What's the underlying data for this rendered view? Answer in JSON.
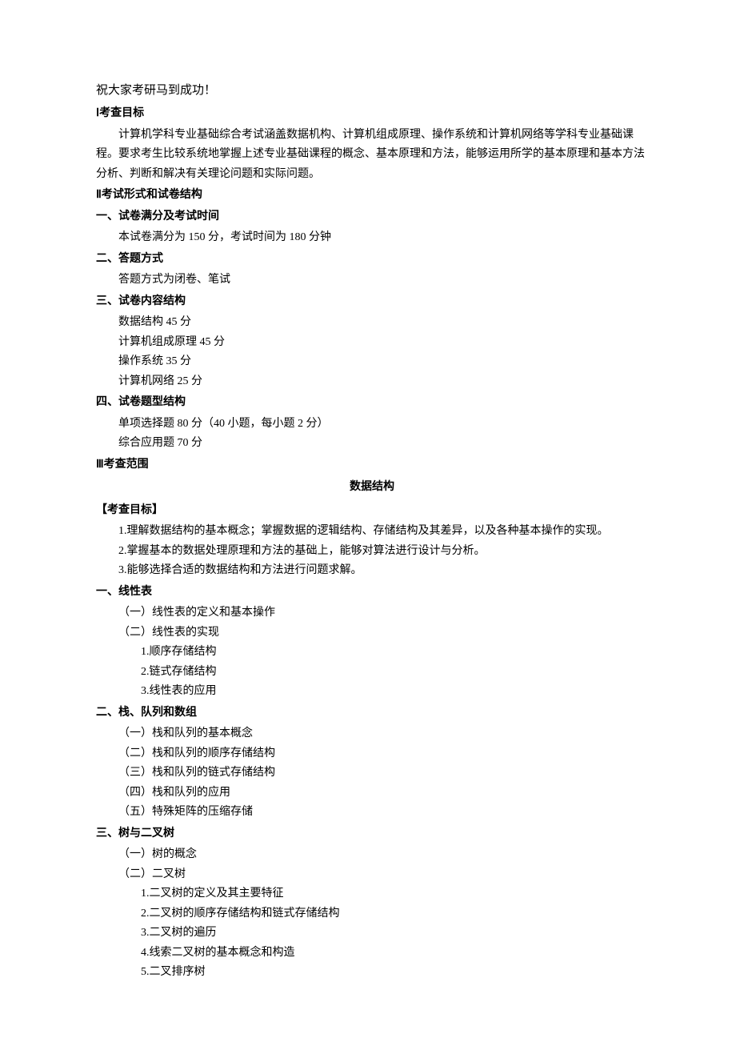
{
  "greeting": "祝大家考研马到成功！",
  "s1": {
    "title": "Ⅰ考查目标",
    "para": "计算机学科专业基础综合考试涵盖数据机构、计算机组成原理、操作系统和计算机网络等学科专业基础课程。要求考生比较系统地掌握上述专业基础课程的概念、基本原理和方法，能够运用所学的基本原理和基本方法分析、判断和解决有关理论问题和实际问题。"
  },
  "s2": {
    "title": "Ⅱ考试形式和试卷结构",
    "sub1": {
      "title": "一、试卷满分及考试时间",
      "line1": "本试卷满分为 150 分，考试时间为 180 分钟"
    },
    "sub2": {
      "title": "二、答题方式",
      "line1": "答题方式为闭卷、笔试"
    },
    "sub3": {
      "title": "三、试卷内容结构",
      "line1": "数据结构 45 分",
      "line2": "计算机组成原理 45 分",
      "line3": "操作系统 35 分",
      "line4": "计算机网络 25 分"
    },
    "sub4": {
      "title": "四、试卷题型结构",
      "line1": "单项选择题 80 分（40 小题，每小题 2 分）",
      "line2": "综合应用题 70 分"
    }
  },
  "s3": {
    "title": "Ⅲ考查范围",
    "centerTitle": "数据结构",
    "goals": {
      "title": "【考查目标】",
      "g1": "1.理解数据结构的基本概念；掌握数据的逻辑结构、存储结构及其差异，以及各种基本操作的实现。",
      "g2": "2.掌握基本的数据处理原理和方法的基础上，能够对算法进行设计与分析。",
      "g3": "3.能够选择合适的数据结构和方法进行问题求解。"
    },
    "p1": {
      "title": "一、线性表",
      "a": "（一）线性表的定义和基本操作",
      "b": "（二）线性表的实现",
      "b1": "1.顺序存储结构",
      "b2": "2.链式存储结构",
      "b3": "3.线性表的应用"
    },
    "p2": {
      "title": "二、栈、队列和数组",
      "a": "（一）栈和队列的基本概念",
      "b": "（二）栈和队列的顺序存储结构",
      "c": "（三）栈和队列的链式存储结构",
      "d": "（四）栈和队列的应用",
      "e": "（五）特殊矩阵的压缩存储"
    },
    "p3": {
      "title": "三、树与二叉树",
      "a": "（一）树的概念",
      "b": "（二）二叉树",
      "b1": "1.二叉树的定义及其主要特征",
      "b2": "2.二叉树的顺序存储结构和链式存储结构",
      "b3": "3.二叉树的遍历",
      "b4": "4.线索二叉树的基本概念和构造",
      "b5": "5.二叉排序树"
    }
  }
}
